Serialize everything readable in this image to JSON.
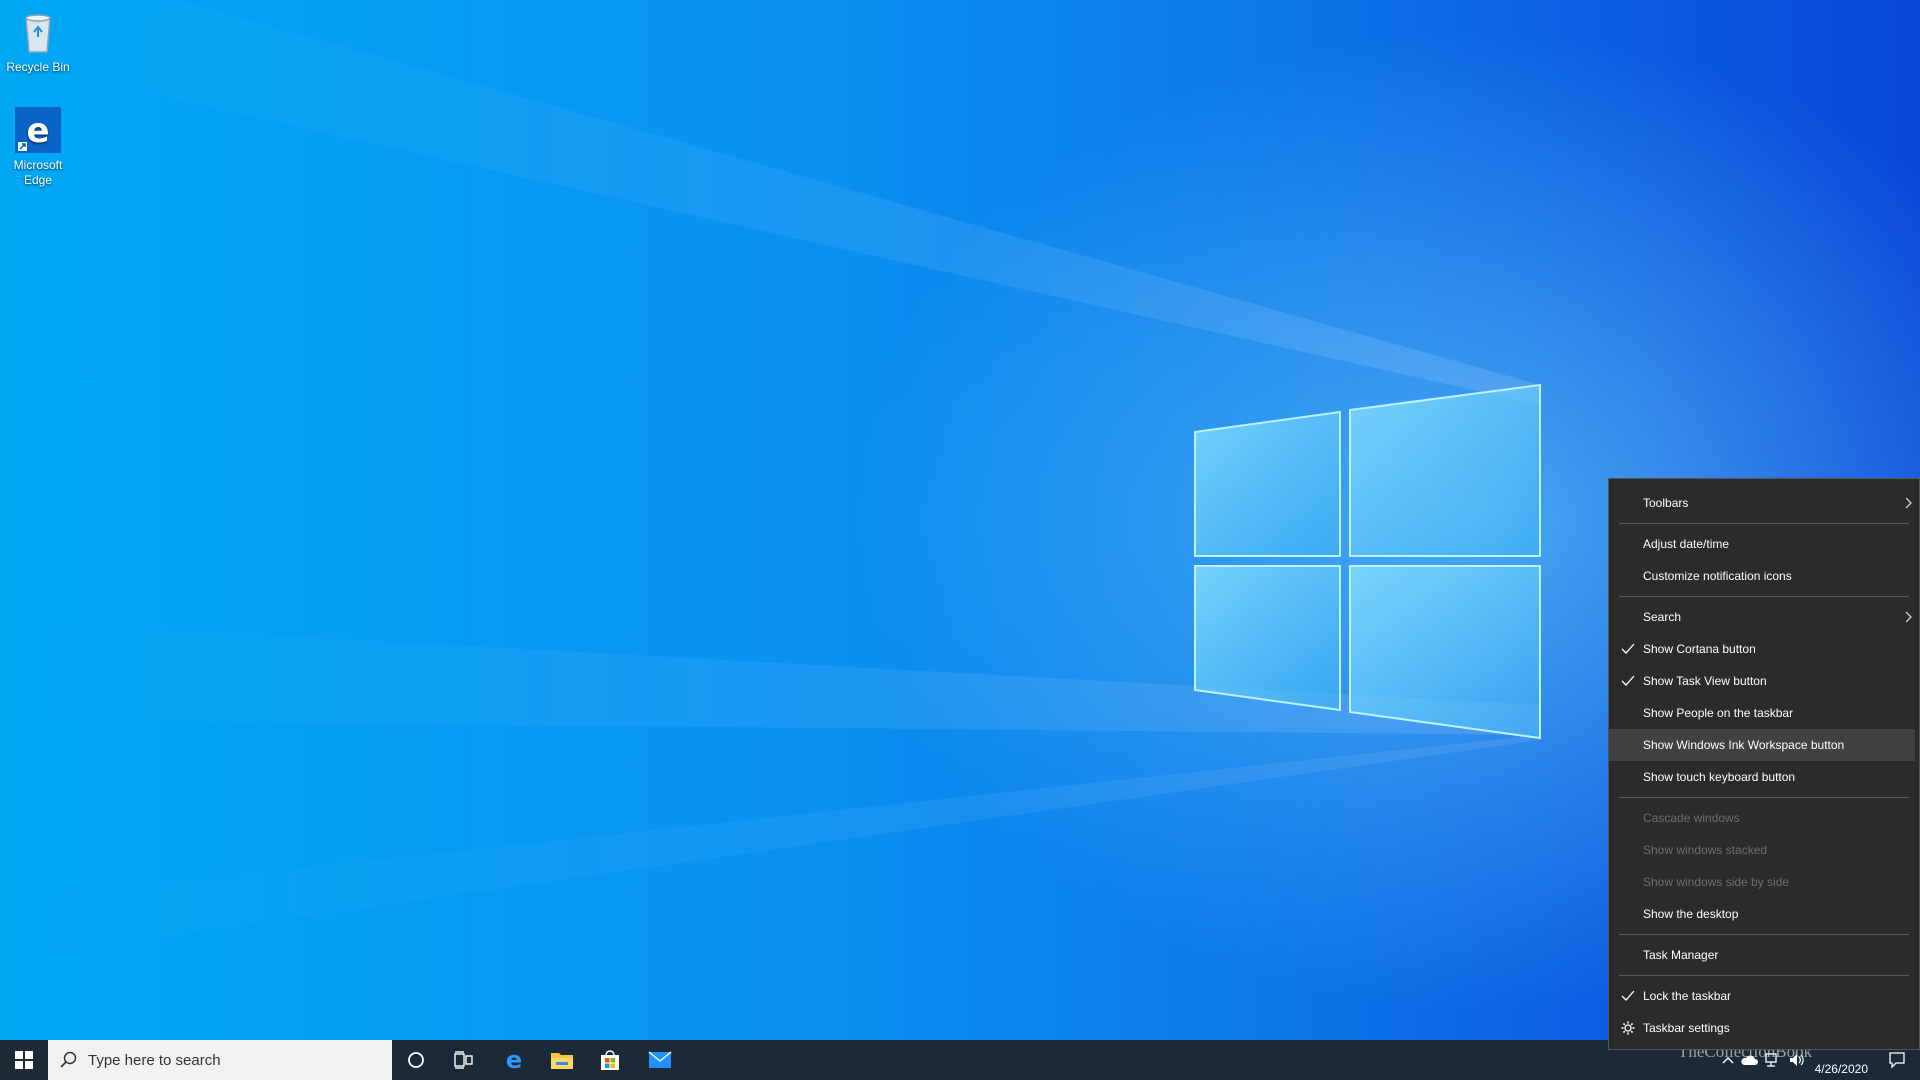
{
  "desktop": {
    "icons": [
      {
        "label": "Recycle Bin",
        "icon": "recycle-bin-icon"
      },
      {
        "label": "Microsoft Edge",
        "icon": "edge-icon"
      }
    ]
  },
  "taskbar": {
    "search_placeholder": "Type here to search",
    "pinned": [
      "cortana-icon",
      "task-view-icon",
      "edge-icon",
      "file-explorer-icon",
      "store-icon",
      "mail-icon"
    ],
    "date": "4/26/2020"
  },
  "watermark": "TheCollectionBook",
  "context_menu": {
    "items": [
      {
        "label": "Toolbars",
        "submenu": true
      },
      {
        "separator": true
      },
      {
        "label": "Adjust date/time"
      },
      {
        "label": "Customize notification icons"
      },
      {
        "separator": true
      },
      {
        "label": "Search",
        "submenu": true
      },
      {
        "label": "Show Cortana button",
        "checked": true
      },
      {
        "label": "Show Task View button",
        "checked": true
      },
      {
        "label": "Show People on the taskbar"
      },
      {
        "label": "Show Windows Ink Workspace button",
        "hover": true
      },
      {
        "label": "Show touch keyboard button"
      },
      {
        "separator": true
      },
      {
        "label": "Cascade windows",
        "disabled": true
      },
      {
        "label": "Show windows stacked",
        "disabled": true
      },
      {
        "label": "Show windows side by side",
        "disabled": true
      },
      {
        "label": "Show the desktop"
      },
      {
        "separator": true
      },
      {
        "label": "Task Manager"
      },
      {
        "separator": true
      },
      {
        "label": "Lock the taskbar",
        "checked": true
      },
      {
        "label": "Taskbar settings",
        "icon": "gear-icon"
      }
    ]
  },
  "colors": {
    "accent": "#0078d7",
    "menu_bg": "#2b2b2b",
    "taskbar_bg": "#1c2a38"
  }
}
